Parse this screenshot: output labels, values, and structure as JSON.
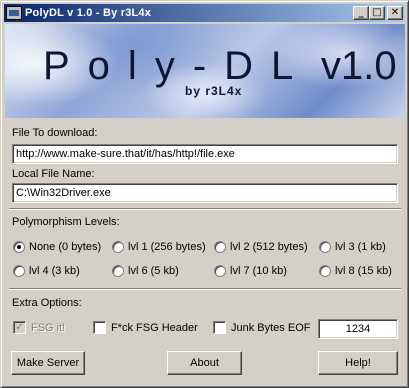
{
  "window": {
    "title": "PolyDL v 1.0 - By r3L4x",
    "minimize_glyph": "_",
    "maximize_glyph": "□",
    "close_glyph": "✕"
  },
  "banner": {
    "title": "Poly-DL",
    "version": "v1.0",
    "byline": "by r3L4x"
  },
  "download": {
    "label": "File To download:",
    "value": "http://www.make-sure.that/it/has/http!/file.exe"
  },
  "local": {
    "label": "Local File Name:",
    "value": "C:\\Win32Driver.exe"
  },
  "polymorphism": {
    "label": "Polymorphism Levels:",
    "selected": "None (0 bytes)",
    "options": [
      {
        "label": "None (0 bytes)",
        "checked": true
      },
      {
        "label": "lvl 1 (256 bytes)",
        "checked": false
      },
      {
        "label": "lvl 2 (512 bytes)",
        "checked": false
      },
      {
        "label": "lvl 3 (1 kb)",
        "checked": false
      },
      {
        "label": "lvl 4 (3 kb)",
        "checked": false
      },
      {
        "label": "lvl 6 (5 kb)",
        "checked": false
      },
      {
        "label": "lvl 7 (10 kb)",
        "checked": false
      },
      {
        "label": "lvl 8 (15 kb)",
        "checked": false
      }
    ]
  },
  "extra": {
    "label": "Extra Options:",
    "fsg": {
      "label": "FSG it!",
      "checked": true,
      "enabled": false
    },
    "fck_header": {
      "label": "F*ck FSG Header",
      "checked": false
    },
    "junk_bytes": {
      "label": "Junk Bytes EOF",
      "checked": false
    },
    "junk_value": "1234"
  },
  "buttons": {
    "make_server": "Make Server",
    "about": "About",
    "help": "Help!"
  }
}
